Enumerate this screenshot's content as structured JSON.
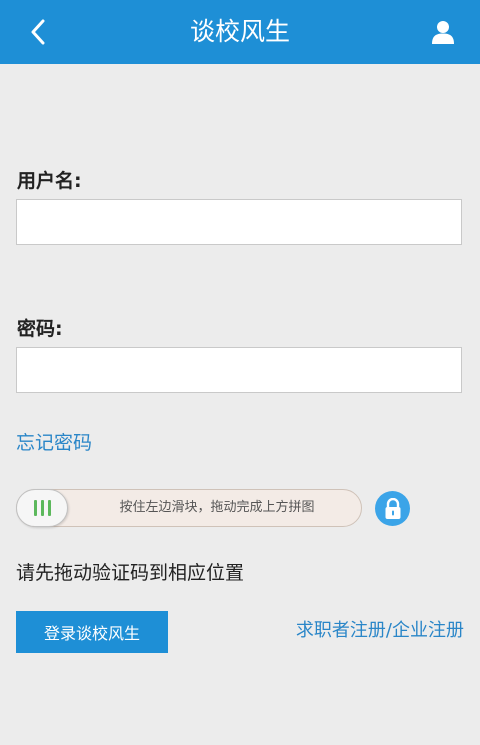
{
  "header": {
    "title": "谈校风生",
    "back_icon": "chevron-left-icon",
    "user_icon": "user-icon",
    "background": "#1e8fd6"
  },
  "form": {
    "username_label": "用户名:",
    "username_value": "",
    "password_label": "密码:",
    "password_value": "",
    "forgot_password": "忘记密码"
  },
  "captcha": {
    "slider_text": "按住左边滑块，拖动完成上方拼图",
    "handle_icon": "grip-lines-icon",
    "lock_icon": "lock-icon",
    "hint": "请先拖动验证码到相应位置"
  },
  "actions": {
    "login_label": "登录谈校风生",
    "jobseeker_register": "求职者注册",
    "separator": "/",
    "company_register": "企业注册"
  }
}
